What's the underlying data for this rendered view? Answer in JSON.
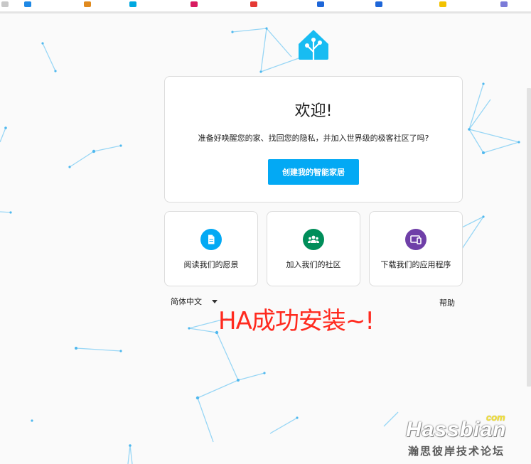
{
  "colors": {
    "primary": "#03a9f4",
    "doc_icon_bg": "#03a9f4",
    "community_icon_bg": "#008e5a",
    "app_icon_bg": "#6f3fa8",
    "overlay_text": "#ff2a1f"
  },
  "bookmarks": [
    {
      "label": "",
      "icon": "bookmark-favicon"
    },
    {
      "label": "",
      "icon": "bookmark-favicon"
    },
    {
      "label": "",
      "icon": "bookmark-favicon"
    },
    {
      "label": "",
      "icon": "bookmark-favicon"
    },
    {
      "label": "",
      "icon": "bookmark-favicon"
    },
    {
      "label": "",
      "icon": "bookmark-favicon"
    },
    {
      "label": "",
      "icon": "bookmark-favicon"
    },
    {
      "label": "",
      "icon": "bookmark-favicon"
    }
  ],
  "logo": {
    "icon": "home-assistant-logo-icon"
  },
  "welcome": {
    "title": "欢迎!",
    "subtitle": "准备好唤醒您的家、找回您的隐私，并加入世界级的极客社区了吗?",
    "create_button": "创建我的智能家居"
  },
  "tiles": [
    {
      "label": "阅读我们的愿景",
      "icon": "document-icon"
    },
    {
      "label": "加入我们的社区",
      "icon": "community-icon"
    },
    {
      "label": "下载我们的应用程序",
      "icon": "devices-icon"
    }
  ],
  "footer": {
    "language": "简体中文",
    "help": "帮助"
  },
  "overlay_text": "HA成功安装~!",
  "watermark": {
    "brand": "Hassbian",
    "com": "com",
    "cn": "瀚思彼岸技术论坛"
  }
}
